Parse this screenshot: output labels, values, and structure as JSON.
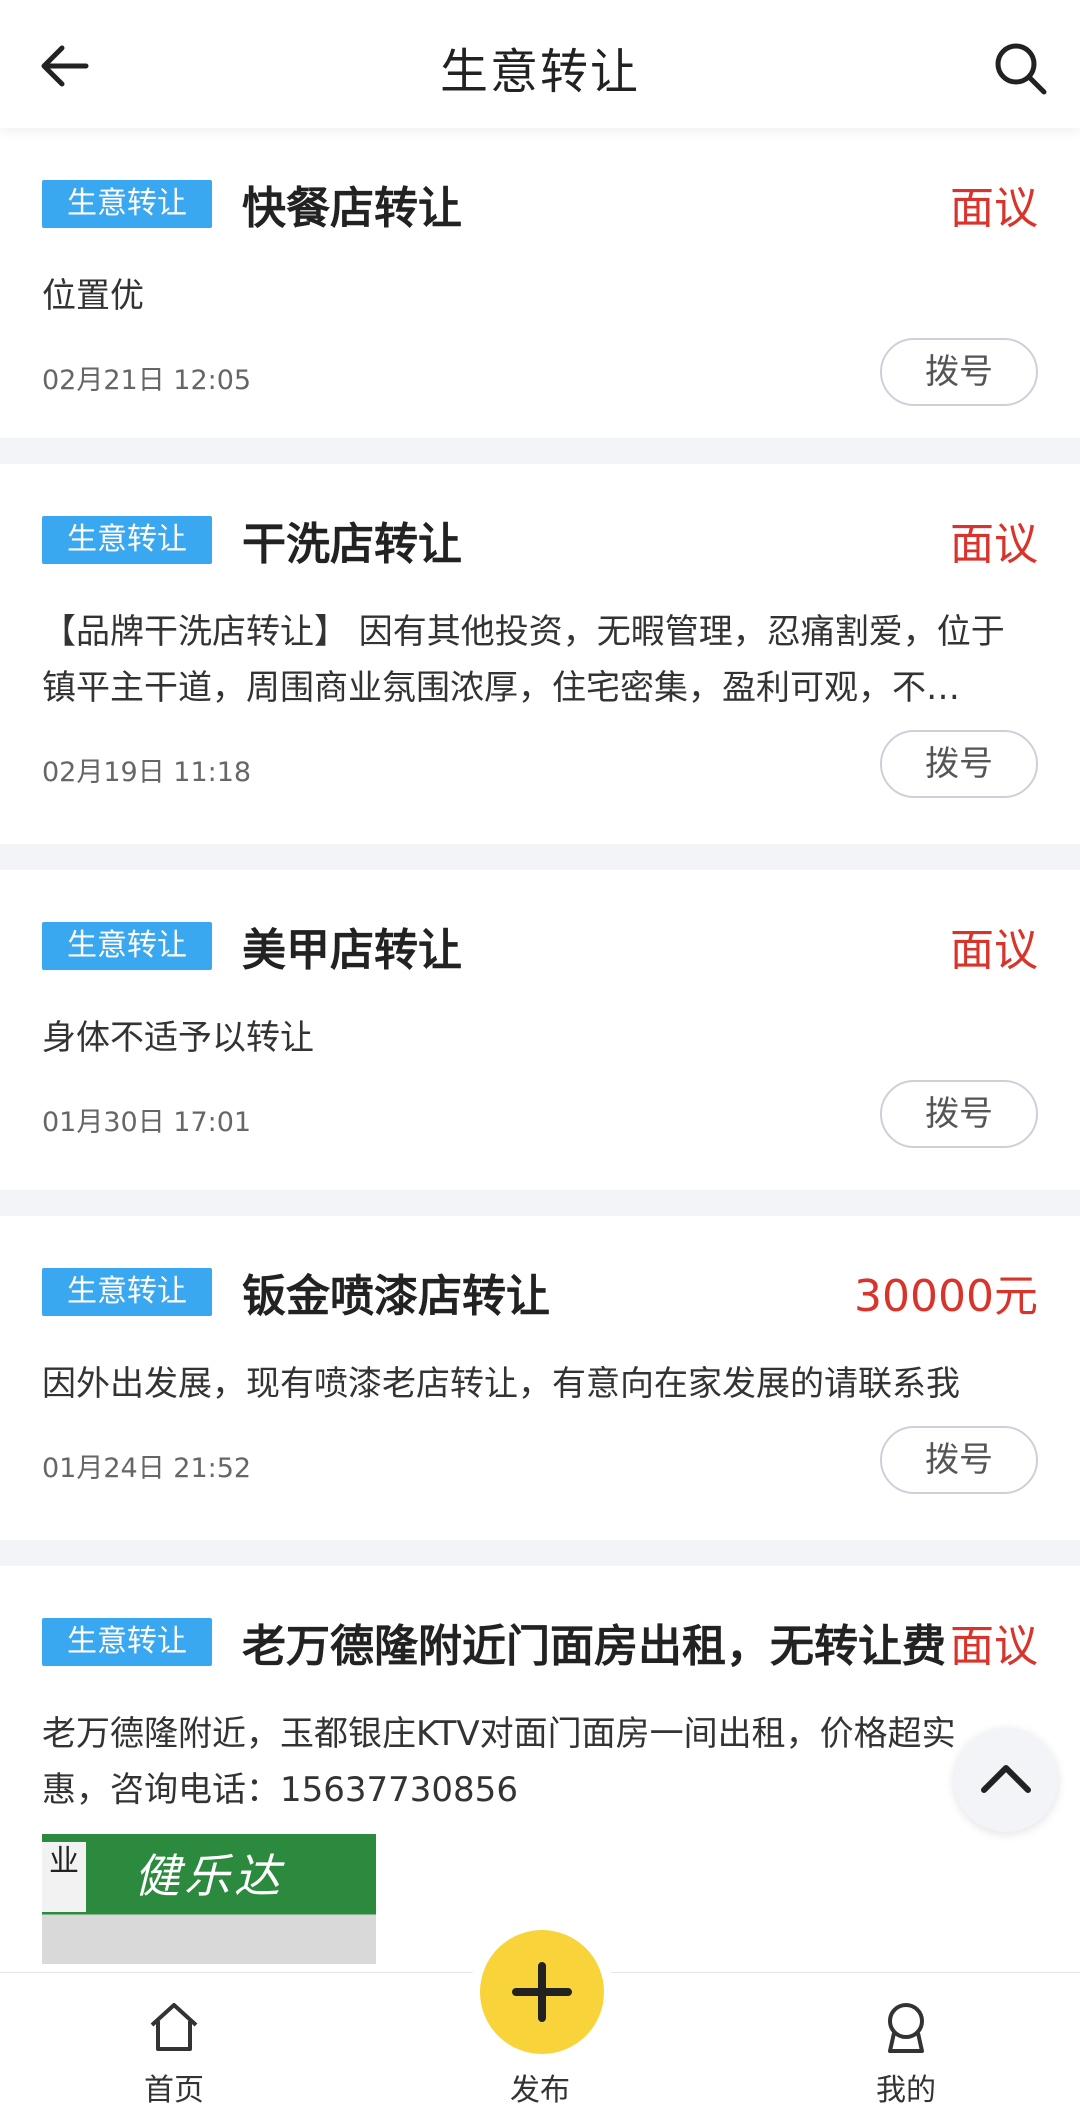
{
  "header": {
    "title": "生意转让",
    "back_icon": "arrow-left-icon",
    "search_icon": "search-icon"
  },
  "listings": [
    {
      "tag": "生意转让",
      "title": "快餐店转让",
      "price": "面议",
      "description": "位置优",
      "time": "02月21日 12:05",
      "dial_label": "拨号"
    },
    {
      "tag": "生意转让",
      "title": "干洗店转让",
      "price": "面议",
      "description": "【品牌干洗店转让】 因有其他投资，无暇管理，忍痛割爱，位于镇平主干道，周围商业氛围浓厚，住宅密集，盈利可观，不…",
      "time": "02月19日 11:18",
      "dial_label": "拨号"
    },
    {
      "tag": "生意转让",
      "title": "美甲店转让",
      "price": "面议",
      "description": "身体不适予以转让",
      "time": "01月30日 17:01",
      "dial_label": "拨号"
    },
    {
      "tag": "生意转让",
      "title": "钣金喷漆店转让",
      "price": "30000元",
      "description": "因外出发展，现有喷漆老店转让，有意向在家发展的请联系我",
      "time": "01月24日 21:52",
      "dial_label": "拨号"
    },
    {
      "tag": "生意转让",
      "title": "老万德隆附近门面房出租，无转让费",
      "price": "面议",
      "description": "老万德隆附近，玉都银庄KTV对面门面房一间出租，价格超实惠，咨询电话：15637730856",
      "thumb_text_left": "业",
      "thumb_text_main": "健乐达"
    }
  ],
  "scroll_top_icon": "chevron-up-icon",
  "bottom_nav": {
    "home": {
      "label": "首页",
      "icon": "home-icon"
    },
    "publish": {
      "label": "发布",
      "icon": "plus-icon"
    },
    "mine": {
      "label": "我的",
      "icon": "user-icon"
    }
  },
  "colors": {
    "tag_bg": "#3aa8f0",
    "price": "#d9342b",
    "fab": "#f8d33a"
  }
}
